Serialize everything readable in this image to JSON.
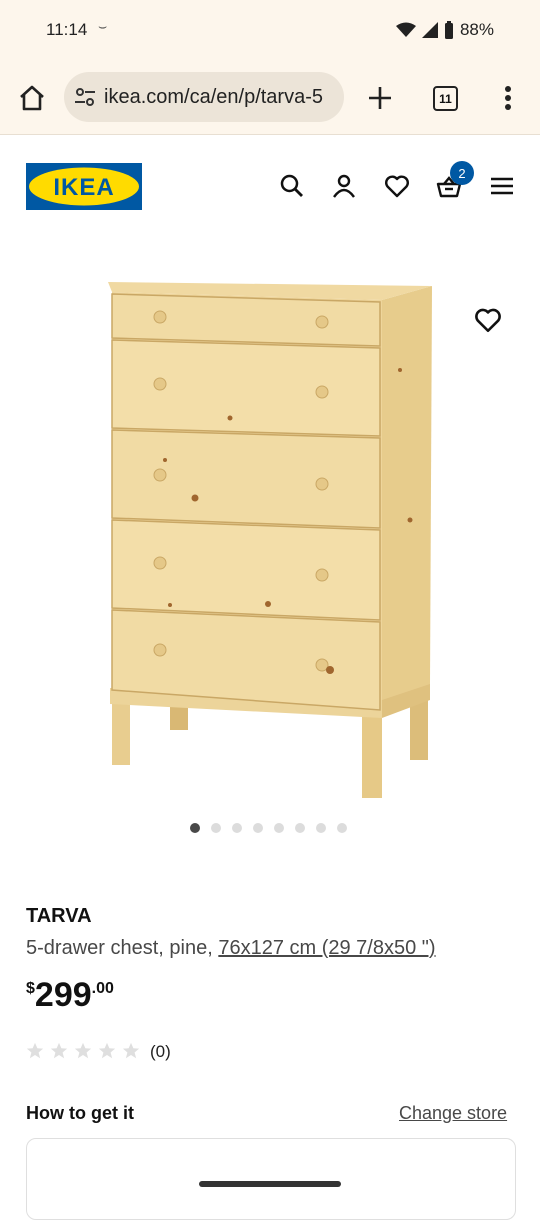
{
  "status": {
    "time": "11:14",
    "sub_glyph": "⌣",
    "battery": "88%"
  },
  "browser": {
    "url": "ikea.com/ca/en/p/tarva-5",
    "tab_count": "11"
  },
  "header": {
    "logo_text": "IKEA",
    "cart_count": "2",
    "colors": {
      "brand_blue": "#0058a3",
      "brand_yellow": "#ffdb00"
    }
  },
  "gallery": {
    "total_images": 8,
    "active_index": 0
  },
  "product": {
    "name": "TARVA",
    "desc_prefix": "5-drawer chest, pine, ",
    "desc_dims": "76x127 cm (29 7/8x50 \")",
    "price_currency": "$",
    "price_int": "299",
    "price_dec": ".00",
    "rating": 0,
    "review_count": "(0)"
  },
  "fulfillment": {
    "heading": "How to get it",
    "change_store": "Change store"
  }
}
